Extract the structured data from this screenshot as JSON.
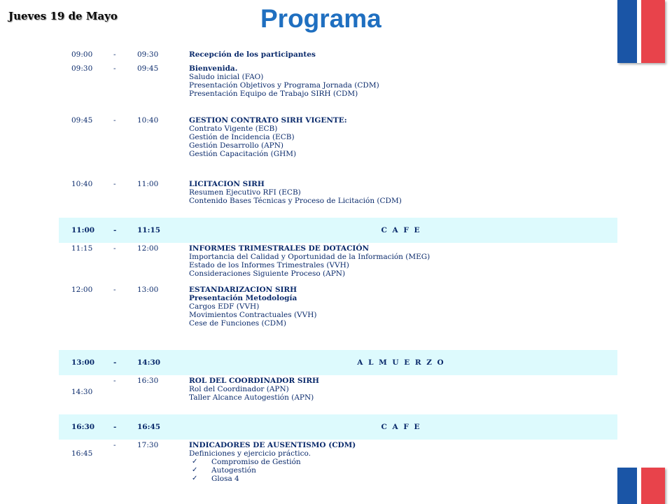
{
  "header": {
    "date": "Jueves 19  de  Mayo",
    "title": "Programa"
  },
  "agenda": [
    {
      "start": "09:00",
      "sep": "-",
      "end": "09:30",
      "heading": "Recepción de los participantes",
      "items": []
    },
    {
      "start": "09:30",
      "sep": "-",
      "end": "09:45",
      "heading": "Bienvenida.",
      "items": [
        "Saludo inicial (FAO)",
        "Presentación Objetivos y Programa Jornada  (CDM)",
        "Presentación Equipo de Trabajo SIRH (CDM)"
      ]
    },
    {
      "start": "09:45",
      "sep": "-",
      "end": "10:40",
      "heading": "GESTION CONTRATO SIRH VIGENTE:",
      "items": [
        "Contrato Vigente (ECB)",
        "Gestión de Incidencia (ECB)",
        "Gestión Desarrollo (APN)",
        "Gestión Capacitación (GHM)"
      ]
    },
    {
      "start": "10:40",
      "sep": "-",
      "end": "11:00",
      "heading": "LICITACION SIRH",
      "items": [
        "Resumen Ejecutivo RFI (ECB)",
        "Contenido Bases Técnicas y Proceso de Licitación (CDM)"
      ]
    },
    {
      "start": "11:00",
      "sep": "-",
      "end": "11:15",
      "label": "C A F E"
    },
    {
      "start": "11:15",
      "sep": "-",
      "end": "12:00",
      "heading": "INFORMES TRIMESTRALES DE DOTACIÓN",
      "items": [
        "Importancia del Calidad y Oportunidad de la Información (MEG)",
        "Estado de los Informes Trimestrales (VVH)",
        "Consideraciones Siguiente Proceso (APN)"
      ]
    },
    {
      "start": "12:00",
      "sep": "-",
      "end": "13:00",
      "heading": "ESTANDARIZACION SIRH",
      "subheading": "Presentación Metodología",
      "items": [
        "Cargos EDF (VVH)",
        "Movimientos Contractuales  (VVH)",
        "Cese de Funciones (CDM)"
      ]
    },
    {
      "start": "13:00",
      "sep": "-",
      "end": "14:30",
      "label": "A L M U E R Z O"
    },
    {
      "start": "14:30",
      "sep": "-",
      "end": "16:30",
      "heading": "ROL DEL COORDINADOR SIRH",
      "items": [
        "Rol del Coordinador  (APN)",
        "Taller Alcance Autogestión  (APN)"
      ]
    },
    {
      "start": "16:30",
      "sep": "-",
      "end": "16:45",
      "label": "C A F E"
    },
    {
      "start": "16:45",
      "sep": "-",
      "end": "17:30",
      "heading": "INDICADORES DE AUSENTISMO (CDM)",
      "items": [
        "Definiciones y ejercicio práctico."
      ],
      "checks": [
        "Compromiso de Gestión",
        "Autogestión",
        "Glosa 4"
      ]
    }
  ]
}
